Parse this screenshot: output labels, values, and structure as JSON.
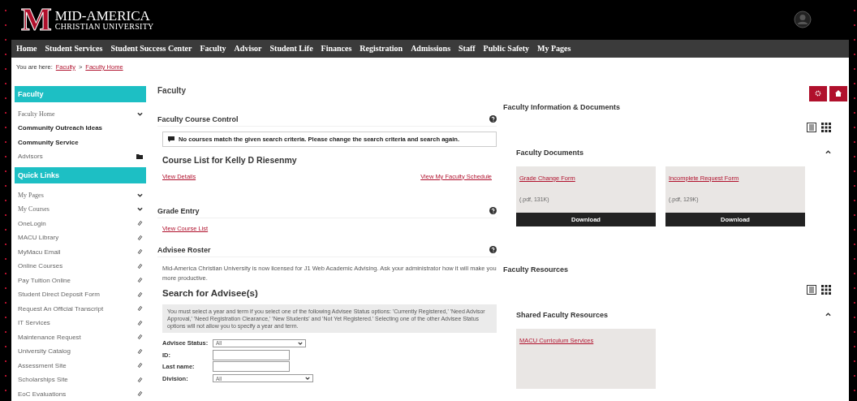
{
  "header": {
    "logo_mark": "M",
    "logo_title": "MID-AMERICA",
    "logo_subtitle": "CHRISTIAN UNIVERSITY"
  },
  "nav": [
    "Home",
    "Student Services",
    "Student Success Center",
    "Faculty",
    "Advisor",
    "Student Life",
    "Finances",
    "Registration",
    "Admissions",
    "Staff",
    "Public Safety",
    "My Pages"
  ],
  "breadcrumb": {
    "label": "You are here:",
    "links": [
      "Faculty",
      "Faculty Home"
    ],
    "separator": ">"
  },
  "sidebar": [
    {
      "title": "Faculty",
      "items": [
        {
          "label": "Faculty Home",
          "kind": "expand"
        },
        {
          "label": "Community Outreach Ideas",
          "kind": "bold"
        },
        {
          "label": "Community Service",
          "kind": "bold"
        },
        {
          "label": "Advisors",
          "kind": "folder"
        }
      ]
    },
    {
      "title": "Quick Links",
      "items": [
        {
          "label": "My Pages",
          "kind": "expand"
        },
        {
          "label": "My Courses",
          "kind": "expand"
        },
        {
          "label": "OneLogin",
          "kind": "link"
        },
        {
          "label": "MACU Library",
          "kind": "link"
        },
        {
          "label": "MyMacu Email",
          "kind": "link"
        },
        {
          "label": "Online Courses",
          "kind": "link"
        },
        {
          "label": "Pay Tuition Online",
          "kind": "link"
        },
        {
          "label": "Student Direct Deposit Form",
          "kind": "link"
        },
        {
          "label": "Request An Official Transcript",
          "kind": "link"
        },
        {
          "label": "IT Services",
          "kind": "link"
        },
        {
          "label": "Maintenance Request",
          "kind": "link"
        },
        {
          "label": "University Catalog",
          "kind": "link"
        },
        {
          "label": "Assessment Site",
          "kind": "link"
        },
        {
          "label": "Scholarships Site",
          "kind": "link"
        },
        {
          "label": "EoC Evaluations",
          "kind": "link"
        }
      ]
    }
  ],
  "main": {
    "title": "Faculty",
    "course_control": {
      "title": "Faculty Course Control",
      "message": "No courses match the given search criteria.  Please change the search criteria and search again.",
      "heading": "Course List for Kelly D Riesenmy",
      "links": [
        "View Details",
        "View My Faculty Schedule"
      ]
    },
    "grade_entry": {
      "title": "Grade Entry",
      "link": "View Course List"
    },
    "advisee_roster": {
      "title": "Advisee Roster",
      "intro": "Mid-America Christian University is now licensed for J1 Web Academic Advising. Ask your administrator how it will make you more productive.",
      "search_heading": "Search for Advisee(s)",
      "note": "You must select a year and term if you select one of the following Advisee Status options: 'Currently Registered,' 'Need Advisor Approval,' 'Need Registration Clearance,' 'New Students' and 'Not Yet Registered.' Selecting one of the other Advisee Status options will not allow you to specify a year and term.",
      "fields": [
        {
          "label": "Advisee Status:",
          "kind": "select",
          "value": "All"
        },
        {
          "label": "ID:",
          "kind": "text"
        },
        {
          "label": "Last name:",
          "kind": "text"
        },
        {
          "label": "Division:",
          "kind": "select",
          "value": "All"
        }
      ]
    }
  },
  "right": {
    "sections": [
      {
        "title": "Faculty Information & Documents",
        "group": "Faculty Documents",
        "expanded": true,
        "cards": [
          {
            "link": "Grade Change Form",
            "meta": "(.pdf, 131K)",
            "button": "Download"
          },
          {
            "link": "Incomplete Request Form",
            "meta": "(.pdf, 129K)",
            "button": "Download"
          }
        ]
      },
      {
        "title": "Faculty Resources",
        "group": "Shared Faculty Resources",
        "expanded": true,
        "cards": [
          {
            "link": "MACU Curriculum Services"
          }
        ]
      }
    ]
  }
}
